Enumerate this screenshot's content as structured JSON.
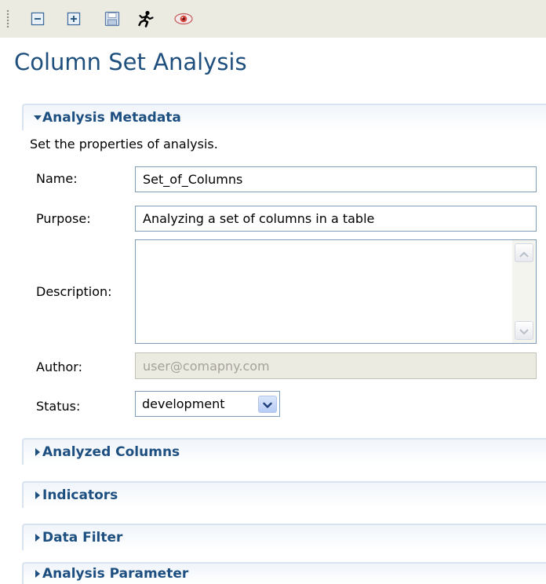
{
  "toolbar": {
    "buttons": [
      {
        "icon": "collapse-all-icon"
      },
      {
        "icon": "expand-all-icon"
      },
      {
        "icon": "save-icon"
      },
      {
        "icon": "run-icon"
      },
      {
        "icon": "view-icon"
      }
    ]
  },
  "page": {
    "title": "Column Set Analysis"
  },
  "sections": {
    "metadata": {
      "title": "Analysis Metadata",
      "expanded": true,
      "description": "Set the properties of analysis."
    },
    "analyzed_columns": {
      "title": "Analyzed Columns",
      "expanded": false
    },
    "indicators": {
      "title": "Indicators",
      "expanded": false
    },
    "data_filter": {
      "title": "Data Filter",
      "expanded": false
    },
    "analysis_parameter": {
      "title": "Analysis Parameter",
      "expanded": false
    }
  },
  "form": {
    "name_label": "Name:",
    "name_value": "Set_of_Columns",
    "purpose_label": "Purpose:",
    "purpose_value": "Analyzing a set of columns in a table",
    "description_label": "Description:",
    "description_value": "",
    "author_label": "Author:",
    "author_value": "user@comapny.com",
    "status_label": "Status:",
    "status_value": "development"
  },
  "colors": {
    "title": "#1f4f7d",
    "section_title": "#1d4f80",
    "toolbar_bg": "#ecebe2",
    "field_border": "#7f9db9"
  }
}
